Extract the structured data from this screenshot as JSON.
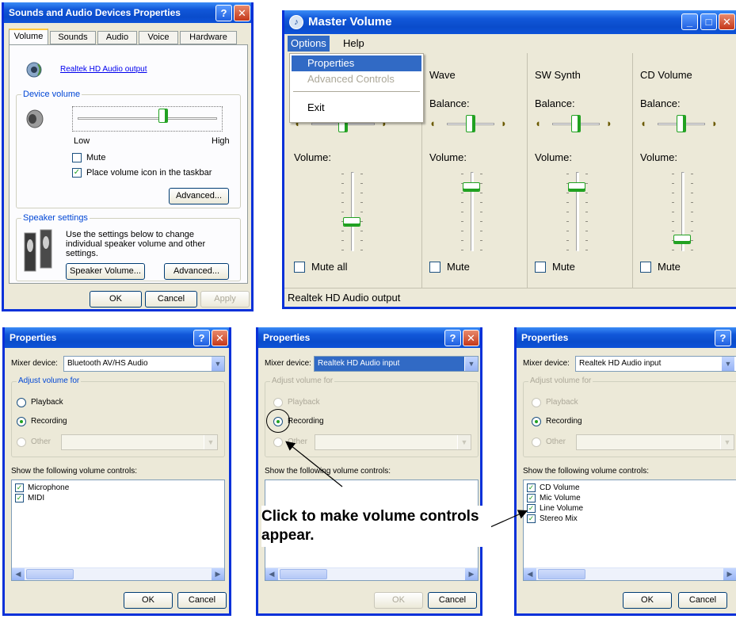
{
  "sad": {
    "title": "Sounds and Audio Devices Properties",
    "tabs": [
      "Volume",
      "Sounds",
      "Audio",
      "Voice",
      "Hardware"
    ],
    "device_link": "Realtek HD Audio output",
    "device_volume_group": "Device volume",
    "low": "Low",
    "high": "High",
    "mute": "Mute",
    "taskbar": "Place volume icon in the taskbar",
    "advanced": "Advanced...",
    "speaker_group": "Speaker settings",
    "speaker_text": "Use the settings below to change individual speaker volume and other settings.",
    "speaker_volume": "Speaker Volume...",
    "advanced2": "Advanced...",
    "ok": "OK",
    "cancel": "Cancel",
    "apply": "Apply",
    "volume_level": 0.62
  },
  "mv": {
    "title": "Master Volume",
    "menu": [
      "Options",
      "Help"
    ],
    "dropdown": [
      "Properties",
      "Advanced Controls",
      "Exit"
    ],
    "columns": [
      {
        "name": "",
        "balance": "",
        "volume": "Volume:",
        "mute": "Mute all",
        "level": 0.35
      },
      {
        "name": "Wave",
        "balance": "Balance:",
        "volume": "Volume:",
        "mute": "Mute",
        "level": 0.85
      },
      {
        "name": "SW Synth",
        "balance": "Balance:",
        "volume": "Volume:",
        "mute": "Mute",
        "level": 0.85
      },
      {
        "name": "CD Volume",
        "balance": "Balance:",
        "volume": "Volume:",
        "mute": "Mute",
        "level": 0.1
      }
    ],
    "status": "Realtek HD Audio output"
  },
  "p1": {
    "title": "Properties",
    "mixer_label": "Mixer device:",
    "mixer_value": "Bluetooth AV/HS Audio",
    "adjust": "Adjust volume for",
    "playback": "Playback",
    "recording": "Recording",
    "other": "Other",
    "show": "Show the following volume controls:",
    "items": [
      "Microphone",
      "MIDI"
    ],
    "ok": "OK",
    "cancel": "Cancel"
  },
  "p2": {
    "title": "Properties",
    "mixer_label": "Mixer device:",
    "mixer_value": "Realtek HD Audio input",
    "adjust": "Adjust volume for",
    "playback": "Playback",
    "recording": "Recording",
    "other": "Other",
    "show": "Show the following volume controls:",
    "ok": "OK",
    "cancel": "Cancel"
  },
  "p3": {
    "title": "Properties",
    "mixer_label": "Mixer device:",
    "mixer_value": "Realtek HD Audio input",
    "adjust": "Adjust volume for",
    "playback": "Playback",
    "recording": "Recording",
    "other": "Other",
    "show": "Show the following volume controls:",
    "items": [
      "CD Volume",
      "Mic Volume",
      "Line Volume",
      "Stereo Mix"
    ],
    "ok": "OK",
    "cancel": "Cancel"
  },
  "annotation": "Click to make volume controls appear."
}
